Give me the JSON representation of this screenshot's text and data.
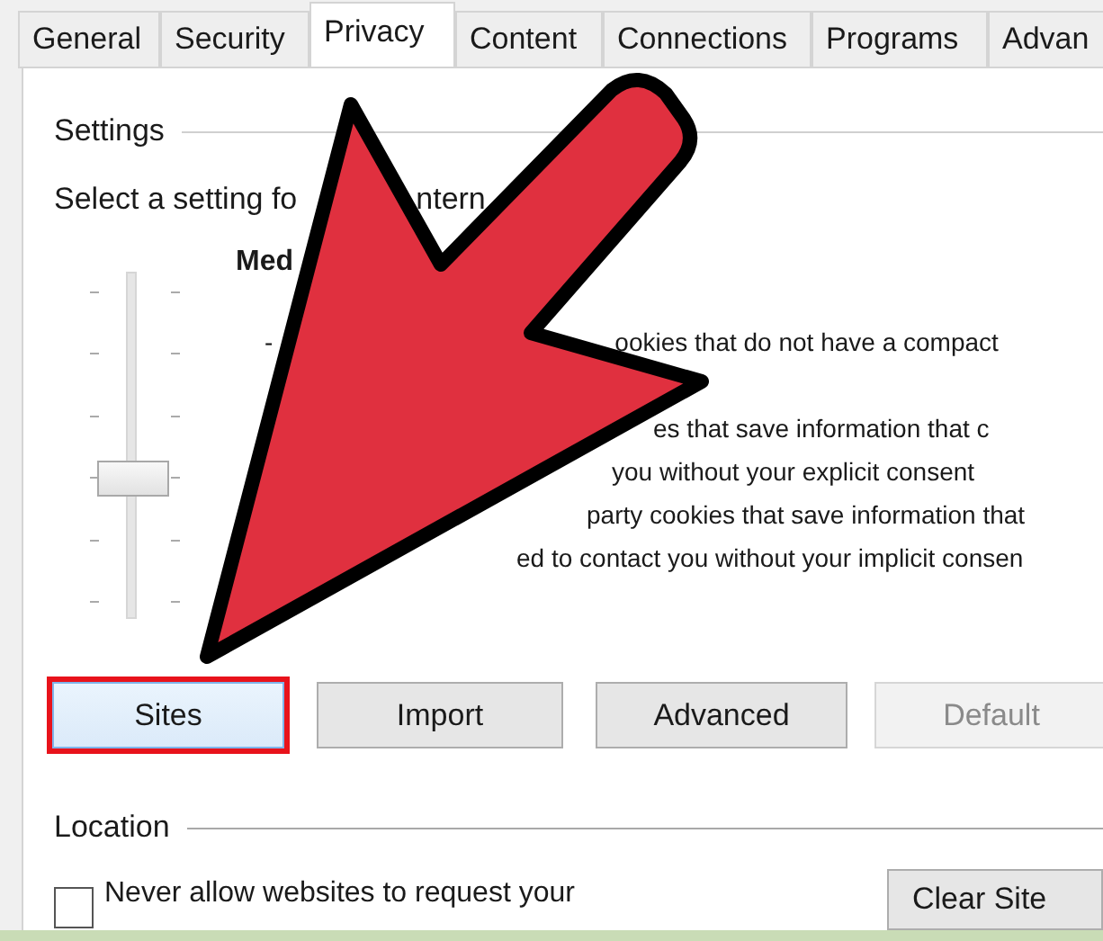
{
  "tabs": [
    {
      "label": "General",
      "selected": false
    },
    {
      "label": "Security",
      "selected": false
    },
    {
      "label": "Privacy",
      "selected": true
    },
    {
      "label": "Content",
      "selected": false
    },
    {
      "label": "Connections",
      "selected": false
    },
    {
      "label": "Programs",
      "selected": false
    },
    {
      "label": "Advan",
      "selected": false
    }
  ],
  "settings": {
    "title": "Settings",
    "intro": [
      "Select a setting fo",
      "ntern"
    ],
    "slider": {
      "level": 0.4
    },
    "level_name": "Med",
    "lines": [
      [
        "-",
        "ookies that do not have a compact"
      ],
      [
        "es that save information that c"
      ],
      [
        "you without your explicit consent"
      ],
      [
        "party cookies that save information that"
      ],
      [
        "ed to contact you without your implicit consen"
      ]
    ]
  },
  "buttons": [
    {
      "label": "Sites",
      "highlighted": true,
      "disabled": false
    },
    {
      "label": "Import",
      "highlighted": false,
      "disabled": false
    },
    {
      "label": "Advanced",
      "highlighted": false,
      "disabled": false
    },
    {
      "label": "Default",
      "highlighted": false,
      "disabled": true
    }
  ],
  "location": {
    "title": "Location",
    "checkbox": {
      "label": [
        "Never allow websites to request your"
      ],
      "checked": false
    },
    "button": "Clear Site"
  }
}
